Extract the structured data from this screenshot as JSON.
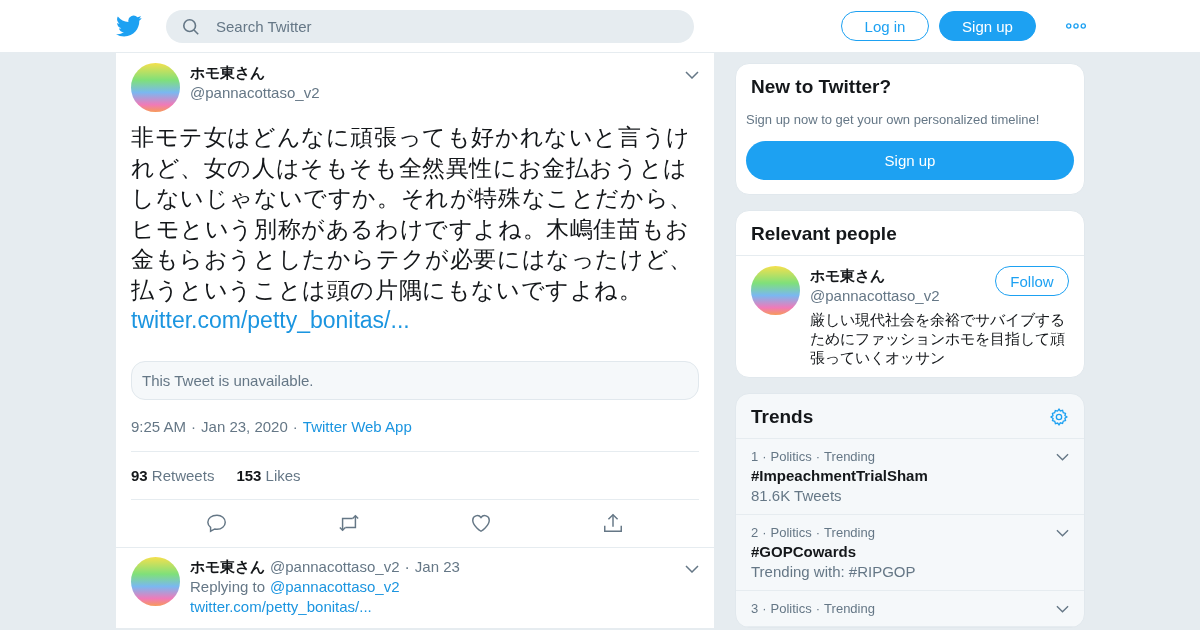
{
  "header": {
    "search": {
      "placeholder": "Search Twitter"
    },
    "buttons": [
      {
        "label": "Log in",
        "kind": "outline"
      },
      {
        "label": "Sign up",
        "kind": "filled"
      }
    ]
  },
  "tweet": {
    "name": "ホモ東さん",
    "handle": "@pannacottaso_v2",
    "text": "非モテ女はどんなに頑張っても好かれないと言うけれど、女の人はそもそも全然異性にお金払おうとはしないじゃないですか。それが特殊なことだから、ヒモという別称があるわけですよね。木嶋佳苗もお金もらおうとしたからテクが必要にはなったけど、払うということは頭の片隅にもないですよね。",
    "link": "twitter.com/petty_bonitas/...",
    "quote": "This Tweet is unavailable.",
    "time": "9:25 AM",
    "date": "Jan 23, 2020",
    "separator": "·",
    "source": "Twitter Web App",
    "retweets": "93",
    "retweets_label": "Retweets",
    "likes": "153",
    "likes_label": "Likes"
  },
  "reply": {
    "name": "ホモ東さん",
    "handle": "@pannacottaso_v2",
    "separator": "·",
    "date": "Jan 23",
    "replying_label": "Replying to",
    "replying_to": "@pannacottaso_v2",
    "link": "twitter.com/petty_bonitas/..."
  },
  "signup_card": {
    "title": "New to Twitter?",
    "text": "Sign up now to get your own personalized timeline!",
    "button": "Sign up"
  },
  "relevant_people": {
    "title": "Relevant people",
    "people": [
      {
        "name": "ホモ東さん",
        "handle": "@pannacottaso_v2",
        "button": "Follow",
        "bio": "厳しい現代社会を余裕でサバイブするためにファッションホモを目指して頑張っていくオッサン"
      }
    ]
  },
  "trends": {
    "title": "Trends",
    "separator": "·",
    "items": [
      {
        "rank": "1",
        "category": "Politics",
        "status": "Trending",
        "tag": "#ImpeachmentTrialSham",
        "meta": "81.6K Tweets"
      },
      {
        "rank": "2",
        "category": "Politics",
        "status": "Trending",
        "tag": "#GOPCowards",
        "meta": "Trending with: #RIPGOP"
      },
      {
        "rank": "3",
        "category": "Politics",
        "status": "Trending"
      }
    ]
  }
}
